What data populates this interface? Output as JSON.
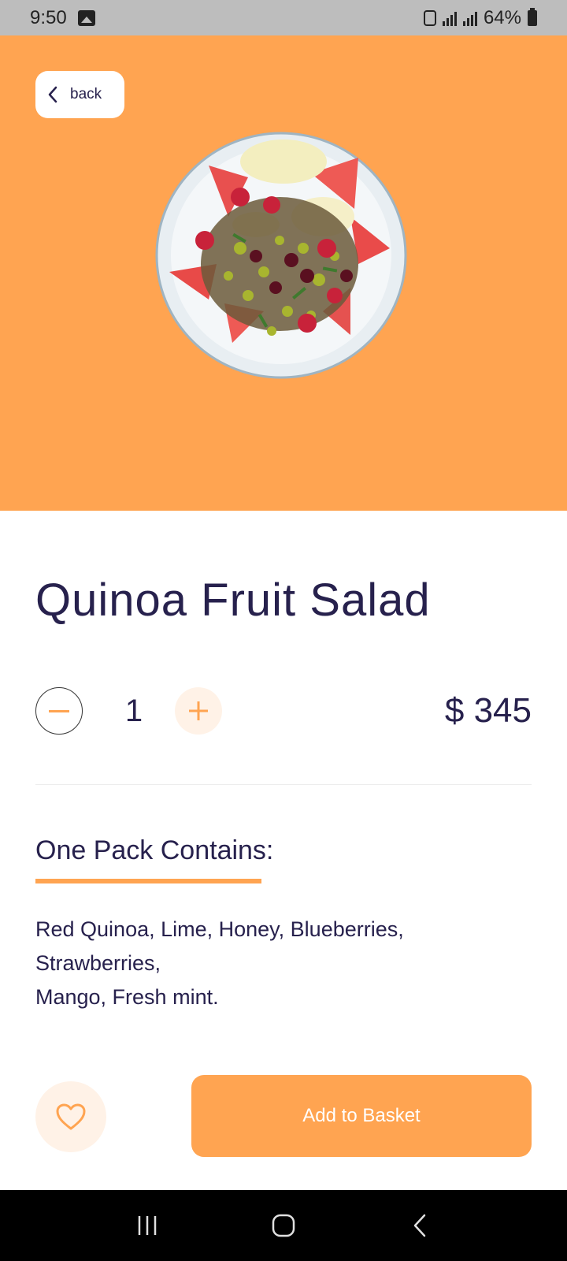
{
  "status_bar": {
    "time": "9:50",
    "battery_percent": "64%"
  },
  "header": {
    "back_label": "back"
  },
  "product": {
    "name": "Quinoa Fruit Salad",
    "quantity": "1",
    "price": "$ 345",
    "section_heading": "One Pack Contains:",
    "contents": "Red Quinoa, Lime, Honey, Blueberries, Strawberries,\n Mango, Fresh mint."
  },
  "actions": {
    "add_to_basket_label": "Add to Basket"
  },
  "colors": {
    "accent": "#FFA451",
    "text": "#27214D",
    "accent_light": "#FFF2E7"
  },
  "icons": {
    "back": "chevron-left-icon",
    "minus": "minus-icon",
    "plus": "plus-icon",
    "favorite": "heart-icon",
    "nav_recents": "recents-icon",
    "nav_home": "home-icon",
    "nav_back": "nav-back-icon"
  }
}
